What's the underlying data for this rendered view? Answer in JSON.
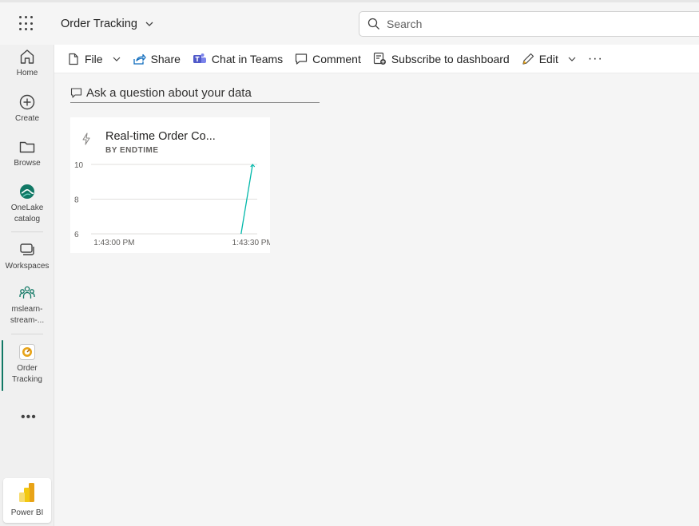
{
  "header": {
    "app_title": "Order Tracking",
    "search_placeholder": "Search"
  },
  "nav": {
    "home": "Home",
    "create": "Create",
    "browse": "Browse",
    "onelake_line1": "OneLake",
    "onelake_line2": "catalog",
    "workspaces": "Workspaces",
    "ws_line1": "mslearn-",
    "ws_line2": "stream-...",
    "order_line1": "Order",
    "order_line2": "Tracking",
    "more": "•••",
    "powerbi": "Power BI"
  },
  "toolbar": {
    "file": "File",
    "share": "Share",
    "chat": "Chat in Teams",
    "comment": "Comment",
    "subscribe": "Subscribe to dashboard",
    "edit": "Edit",
    "more": "···"
  },
  "qna": {
    "placeholder": "Ask a question about your data"
  },
  "tile": {
    "title": "Real-time Order Co...",
    "subtitle": "BY ENDTIME"
  },
  "colors": {
    "accent": "#117865",
    "line": "#01B8AA"
  },
  "chart_data": {
    "type": "line",
    "x": [
      "1:43:00 PM",
      "1:43:30 PM"
    ],
    "ylim": [
      6,
      10
    ],
    "yticks": [
      10,
      8,
      6
    ],
    "series": [
      {
        "points": [
          {
            "t": 27.5,
            "y": 6
          },
          {
            "t": 30,
            "y": 10
          }
        ]
      }
    ],
    "xticks": [
      {
        "label": "1:43:00 PM",
        "t": 0
      },
      {
        "label": "1:43:30 PM",
        "t": 30
      }
    ],
    "xlim_sec": [
      -5,
      31
    ],
    "grid": true
  }
}
